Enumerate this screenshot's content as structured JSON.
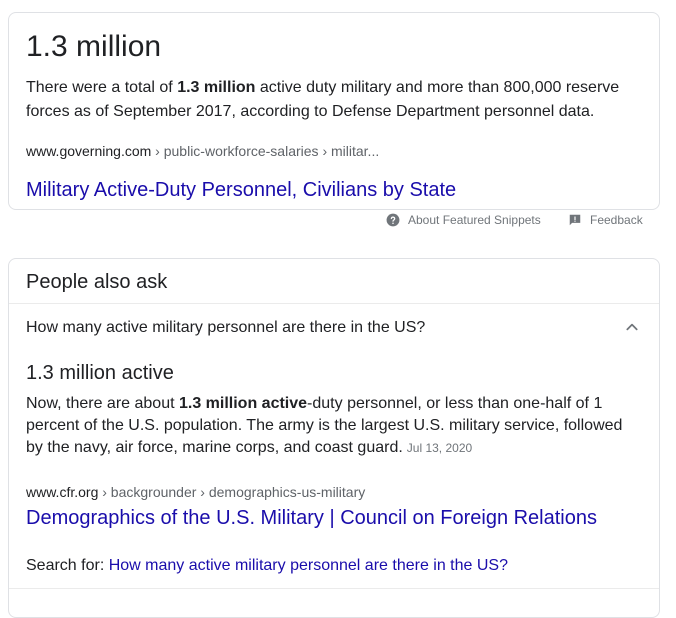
{
  "snippet": {
    "answer": "1.3 million",
    "desc_pre": "There were a total of ",
    "desc_bold": "1.3 million",
    "desc_post": " active duty military and more than 800,000 reserve forces as of September 2017, according to Defense Department personnel data.",
    "domain": "www.governing.com",
    "crumbs": " › public-workforce-salaries › militar...",
    "link_title": "Military Active-Duty Personnel, Civilians by State"
  },
  "meta": {
    "about_label": "About Featured Snippets",
    "feedback_label": "Feedback",
    "about_icon": "help-circle-icon",
    "feedback_icon": "feedback-icon"
  },
  "paa": {
    "title": "People also ask",
    "question": "How many active military personnel are there in the US?",
    "chevron_icon": "chevron-up-icon",
    "answer_title": "1.3 million active",
    "answer_pre": "Now, there are about ",
    "answer_bold": "1.3 million active",
    "answer_post": "-duty personnel, or less than one-half of 1 percent of the U.S. population. The army is the largest U.S. military service, followed by the navy, air force, marine corps, and coast guard.",
    "answer_date": "Jul 13, 2020",
    "domain": "www.cfr.org",
    "crumbs": " › backgrounder › demographics-us-military",
    "link_title": "Demographics of the U.S. Military | Council on Foreign Relations",
    "search_for_label": "Search for: ",
    "search_for_query": "How many active military personnel are there in the US?"
  },
  "colors": {
    "link": "#1a0dab",
    "text": "#202124",
    "muted": "#70757a",
    "border": "#dfe1e5"
  }
}
